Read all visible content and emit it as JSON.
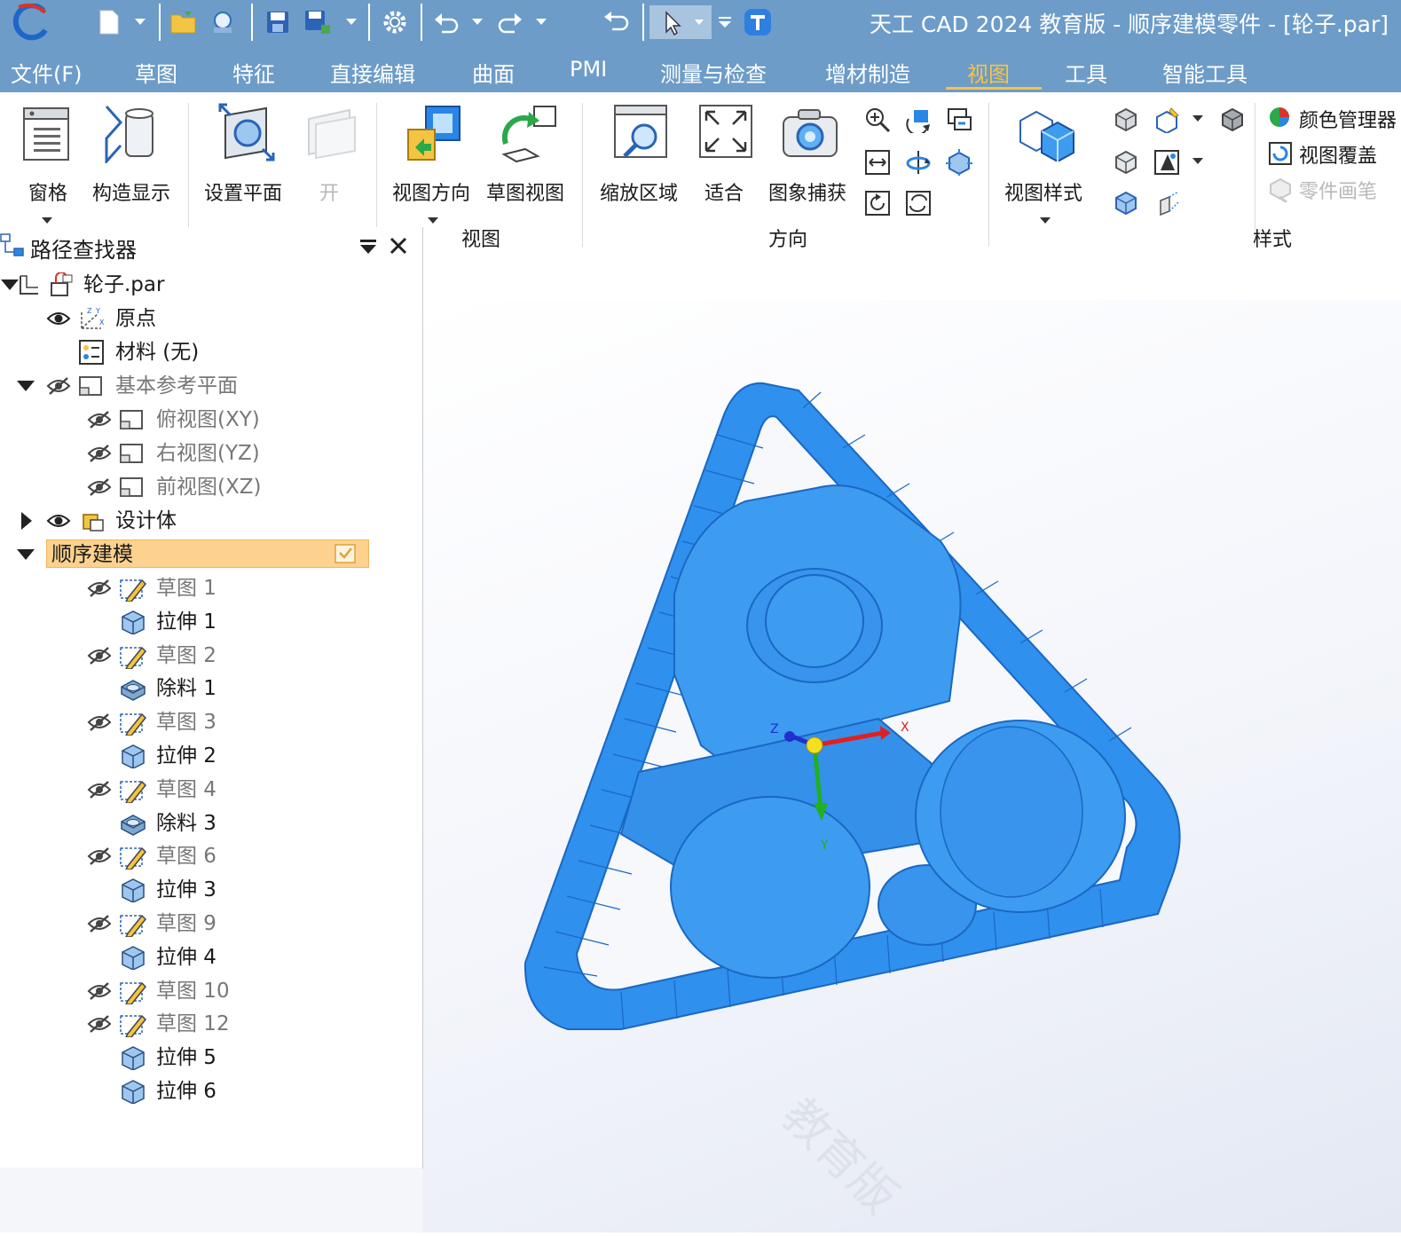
{
  "window": {
    "title": "天工 CAD 2024 教育版 - 顺序建模零件 - [轮子.par]"
  },
  "menu": {
    "items": [
      "文件(F)",
      "草图",
      "特征",
      "直接编辑",
      "曲面",
      "PMI",
      "测量与检查",
      "增材制造",
      "视图",
      "工具",
      "智能工具"
    ],
    "active": "视图"
  },
  "ribbon": {
    "pane_btn": "窗格",
    "construct_btn": "构造显示",
    "setplane_btn": "设置平面",
    "open_btn": "开",
    "viewdir_btn": "视图方向",
    "sketchview_btn": "草图视图",
    "zoomarea_btn": "缩放区域",
    "fit_btn": "适合",
    "capture_btn": "图象捕获",
    "viewstyle_btn": "视图样式",
    "color_mgr": "颜色管理器",
    "view_override": "视图覆盖",
    "part_painter": "零件画笔",
    "group_view": "视图",
    "group_orient": "方向",
    "group_style": "样式"
  },
  "pathfinder": {
    "title": "路径查找器",
    "root": "轮子.par",
    "origin": "原点",
    "material": "材料 (无)",
    "base_planes": "基本参考平面",
    "planes": [
      "俯视图(XY)",
      "右视图(YZ)",
      "前视图(XZ)"
    ],
    "design_body": "设计体",
    "ordered": "顺序建模",
    "features": [
      {
        "label": "草图 1",
        "kind": "sketch"
      },
      {
        "label": "拉伸 1",
        "kind": "extrude"
      },
      {
        "label": "草图 2",
        "kind": "sketch"
      },
      {
        "label": "除料 1",
        "kind": "cut"
      },
      {
        "label": "草图 3",
        "kind": "sketch"
      },
      {
        "label": "拉伸 2",
        "kind": "extrude"
      },
      {
        "label": "草图 4",
        "kind": "sketch"
      },
      {
        "label": "除料 3",
        "kind": "cut"
      },
      {
        "label": "草图 6",
        "kind": "sketch"
      },
      {
        "label": "拉伸 3",
        "kind": "extrude"
      },
      {
        "label": "草图 9",
        "kind": "sketch"
      },
      {
        "label": "拉伸 4",
        "kind": "extrude"
      },
      {
        "label": "草图 10",
        "kind": "sketch"
      },
      {
        "label": "草图 12",
        "kind": "sketch"
      },
      {
        "label": "拉伸 5",
        "kind": "extrude"
      },
      {
        "label": "拉伸 6",
        "kind": "extrude"
      }
    ]
  },
  "viewport": {
    "axis_x": "X",
    "axis_y": "Y",
    "axis_z": "Z",
    "watermark": "教育版",
    "model_color": "#3d9cf0"
  }
}
